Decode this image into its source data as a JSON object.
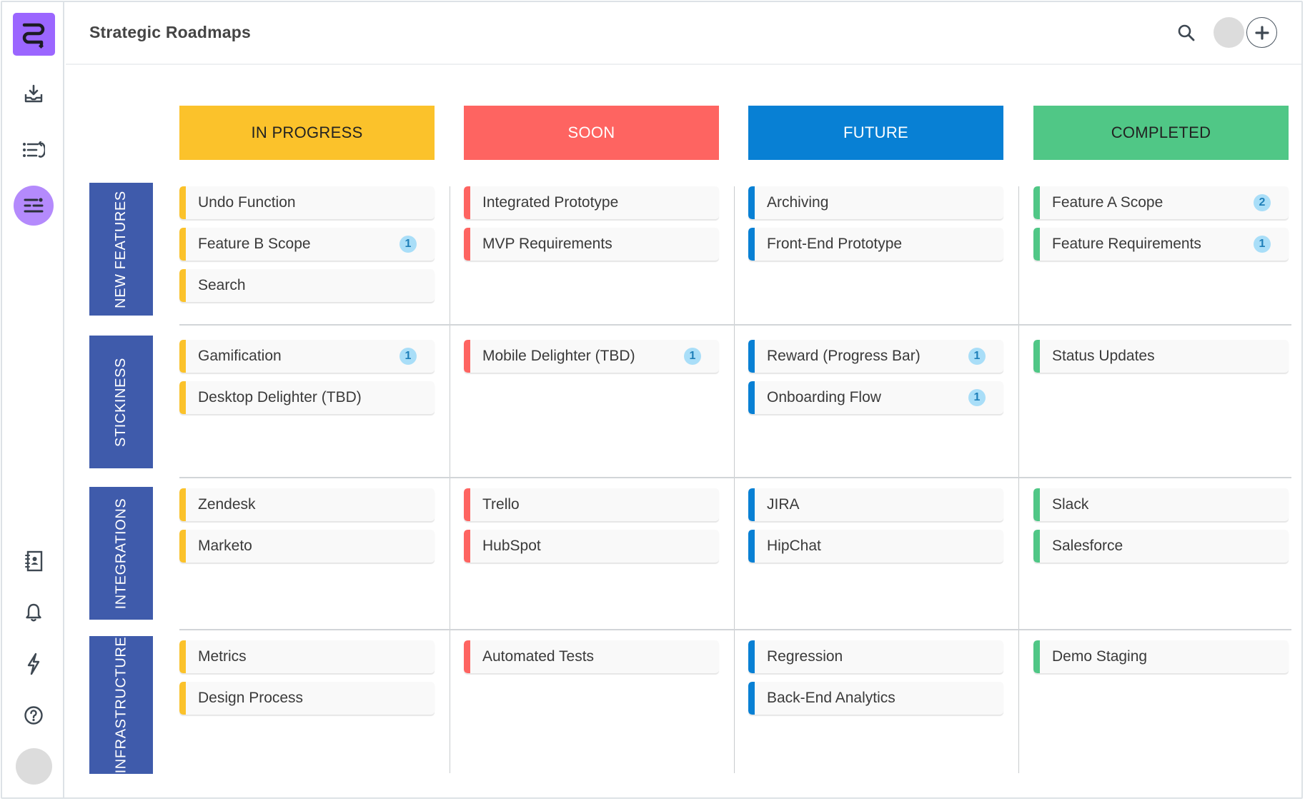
{
  "app": {
    "title": "Strategic Roadmaps"
  },
  "sidebar": {
    "logo": "roadmap-logo",
    "items": [
      {
        "name": "import",
        "icon": "inbox-download-icon"
      },
      {
        "name": "backlog",
        "icon": "list-return-icon"
      },
      {
        "name": "roadmaps",
        "icon": "sliders-list-icon",
        "active": true
      },
      {
        "name": "contacts",
        "icon": "address-book-icon"
      },
      {
        "name": "notifications",
        "icon": "bell-icon"
      },
      {
        "name": "activity",
        "icon": "lightning-icon"
      },
      {
        "name": "help",
        "icon": "question-circle-icon"
      }
    ]
  },
  "toolbar": {
    "search_icon": "search-icon",
    "add_icon": "plus-icon"
  },
  "columns": [
    {
      "label": "IN PROGRESS",
      "color": "#fbc22b",
      "text_color": "#222222"
    },
    {
      "label": "SOON",
      "color": "#fe6461",
      "text_color": "#ffffff"
    },
    {
      "label": "FUTURE",
      "color": "#0880d4",
      "text_color": "#ffffff"
    },
    {
      "label": "COMPLETED",
      "color": "#50c786",
      "text_color": "#222222"
    }
  ],
  "rows": [
    {
      "label": "NEW FEATURES",
      "cells": [
        [
          {
            "title": "Undo Function"
          },
          {
            "title": "Feature B Scope",
            "badge": "1"
          },
          {
            "title": "Search"
          }
        ],
        [
          {
            "title": "Integrated Prototype"
          },
          {
            "title": "MVP Requirements"
          }
        ],
        [
          {
            "title": "Archiving"
          },
          {
            "title": "Front-End Prototype"
          }
        ],
        [
          {
            "title": "Feature A Scope",
            "badge": "2"
          },
          {
            "title": "Feature Requirements",
            "badge": "1"
          }
        ]
      ]
    },
    {
      "label": "STICKINESS",
      "cells": [
        [
          {
            "title": "Gamification",
            "badge": "1"
          },
          {
            "title": "Desktop Delighter (TBD)"
          }
        ],
        [
          {
            "title": "Mobile Delighter (TBD)",
            "badge": "1"
          }
        ],
        [
          {
            "title": "Reward (Progress Bar)",
            "badge": "1"
          },
          {
            "title": "Onboarding Flow",
            "badge": "1"
          }
        ],
        [
          {
            "title": "Status Updates"
          }
        ]
      ]
    },
    {
      "label": "INTEGRATIONS",
      "cells": [
        [
          {
            "title": "Zendesk"
          },
          {
            "title": "Marketo"
          }
        ],
        [
          {
            "title": "Trello"
          },
          {
            "title": "HubSpot"
          }
        ],
        [
          {
            "title": "JIRA"
          },
          {
            "title": "HipChat"
          }
        ],
        [
          {
            "title": "Slack"
          },
          {
            "title": "Salesforce"
          }
        ]
      ]
    },
    {
      "label": "INFRASTRUCTURE",
      "cells": [
        [
          {
            "title": "Metrics"
          },
          {
            "title": "Design Process"
          }
        ],
        [
          {
            "title": "Automated Tests"
          }
        ],
        [
          {
            "title": "Regression"
          },
          {
            "title": "Back-End Analytics"
          }
        ],
        [
          {
            "title": "Demo Staging"
          }
        ]
      ]
    }
  ]
}
